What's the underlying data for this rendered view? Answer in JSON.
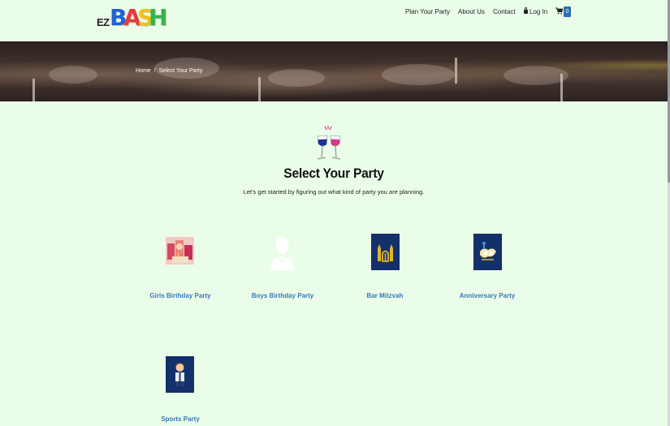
{
  "logo": {
    "ez": "EZ",
    "bash_letters": [
      "B",
      "A",
      "S",
      "H"
    ],
    "bash_colors": [
      "#1e63d6",
      "#e43c3c",
      "#f0c11b",
      "#36b24a"
    ]
  },
  "nav": {
    "items": [
      "Plan Your Party",
      "About Us",
      "Contact",
      "Log In"
    ],
    "cart_count": "0",
    "icons": {
      "login": "lock-icon",
      "cart": "cart-icon"
    }
  },
  "breadcrumb": {
    "home": "Home",
    "separator": "/",
    "current": "Select Your Party"
  },
  "main": {
    "title": "Select Your Party",
    "subtitle": "Let's get started by figuring out what kind of party you are planning.",
    "parties": [
      {
        "label": "Girls Birthday Party",
        "image": "girls-birthday-photo"
      },
      {
        "label": "Boys Birthday Party",
        "image": "boy-avatar-placeholder"
      },
      {
        "label": "Bar Mitzvah",
        "image": "bar-mitzvah-icon"
      },
      {
        "label": "Anniversary Party",
        "image": "anniversary-icon"
      },
      {
        "label": "Sports Party",
        "image": "sports-player-icon"
      }
    ]
  },
  "colors": {
    "page_bg": "#eafde9",
    "link_blue": "#3a78b8",
    "badge_blue": "#2a6fae",
    "tile_navy": "#13306a",
    "gold": "#e1b62a"
  }
}
